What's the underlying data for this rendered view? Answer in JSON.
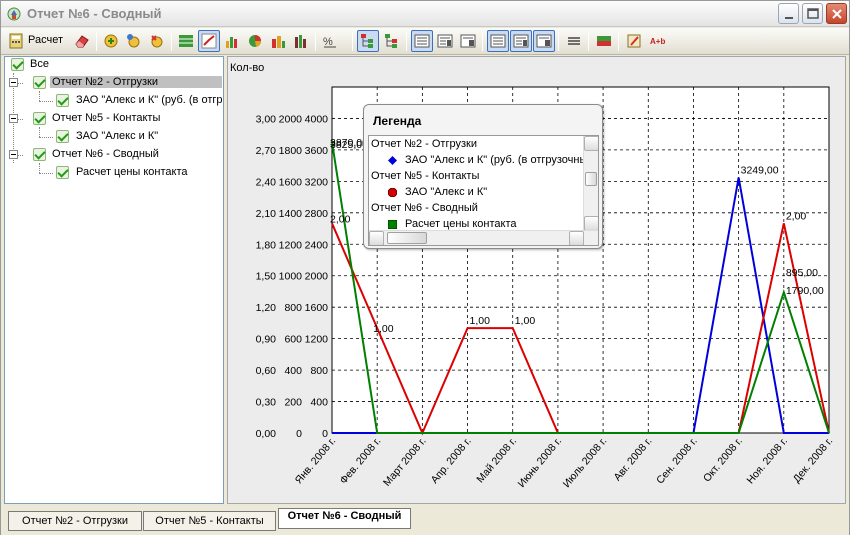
{
  "window": {
    "title": "Отчет №6 - Сводный"
  },
  "toolbar": {
    "calc_label": "Расчет",
    "icons": [
      "eraser-icon",
      "add-report-icon",
      "add-item-icon",
      "add-group-icon",
      "grid-icon",
      "line-chart-icon",
      "bar-chart-icon",
      "pie-chart-icon",
      "chart-3d-icon",
      "column-chart-icon",
      "percent-icon",
      "tree-view-icon",
      "tree-expand-icon",
      "layout-1-icon",
      "layout-2-icon",
      "layout-3-icon",
      "layout-4-icon",
      "layout-5-icon",
      "layout-6-icon",
      "lines-icon",
      "table-icon",
      "edit-icon",
      "font-icon"
    ]
  },
  "tree": {
    "items": [
      {
        "label": "Все"
      },
      {
        "label": "Отчет №2 - Отгрузки"
      },
      {
        "label": "ЗАО \"Алекс и К\" (руб. (в отгр"
      },
      {
        "label": "Отчет №5 - Контакты"
      },
      {
        "label": "ЗАО \"Алекс и К\""
      },
      {
        "label": "Отчет №6 - Сводный"
      },
      {
        "label": "Расчет цены контакта"
      }
    ]
  },
  "legend": {
    "title": "Легенда",
    "rows": [
      {
        "text": "Отчет №2 - Отгрузки",
        "marker": "none"
      },
      {
        "text": "ЗАО \"Алекс и К\" (руб. (в отгрузочны",
        "marker": "diamond",
        "color": "#0000dd"
      },
      {
        "text": "Отчет №5 - Контакты",
        "marker": "none"
      },
      {
        "text": "ЗАО \"Алекс и К\"",
        "marker": "circle",
        "color": "#dd0000"
      },
      {
        "text": "Отчет №6 - Сводный",
        "marker": "none"
      },
      {
        "text": "Расчет цены контакта",
        "marker": "square",
        "color": "#008000"
      }
    ]
  },
  "chart_data": {
    "type": "line",
    "ylabel": "Кол-во",
    "categories": [
      "Янв. 2008 г.",
      "Фев. 2008 г.",
      "Март 2008 г.",
      "Апр. 2008 г.",
      "Май 2008 г.",
      "Июнь 2008 г.",
      "Июль 2008 г.",
      "Авг. 2008 г.",
      "Сен. 2008 г.",
      "Окт. 2008 г.",
      "Ноя. 2008 г.",
      "Дек. 2008 г."
    ],
    "y_axes": [
      {
        "ylim": [
          0,
          3.3
        ],
        "ticks": [
          "0,00",
          "0,30",
          "0,60",
          "0,90",
          "1,20",
          "1,50",
          "1,80",
          "2,10",
          "2,40",
          "2,70",
          "3,00"
        ]
      },
      {
        "ylim": [
          0,
          2200
        ],
        "ticks": [
          "0",
          "200",
          "400",
          "600",
          "800",
          "1000",
          "1200",
          "1400",
          "1600",
          "1800",
          "2000"
        ]
      },
      {
        "ylim": [
          0,
          4400
        ],
        "ticks": [
          "0",
          "400",
          "800",
          "1200",
          "1600",
          "2000",
          "2400",
          "2800",
          "3200",
          "3600",
          "4000"
        ]
      }
    ],
    "series": [
      {
        "name": "ЗАО \"Алекс и К\" (руб. (в отгрузочны",
        "color": "#0000dd",
        "axis": 2,
        "values": [
          0,
          0,
          0,
          0,
          0,
          0,
          0,
          0,
          0,
          3249,
          0,
          0
        ],
        "labels": [
          "",
          "",
          "",
          "",
          "",
          "",
          "",
          "",
          "",
          "3249,00",
          "",
          ""
        ]
      },
      {
        "name": "ЗАО \"Алекс и К\"",
        "color": "#dd0000",
        "axis": 0,
        "values": [
          2,
          1,
          0,
          1,
          1,
          0,
          0,
          0,
          0,
          0,
          2,
          0
        ],
        "labels": [
          "2,00",
          "1,00",
          "",
          "1,00",
          "1,00",
          "",
          "",
          "",
          "",
          "",
          "2,00",
          ""
        ]
      },
      {
        "name": "Расчет цены контакта",
        "color": "#008000",
        "axis": 1,
        "values": [
          1850,
          0,
          0,
          0,
          0,
          0,
          0,
          0,
          0,
          0,
          895,
          0
        ],
        "labels": [
          "3825,00",
          "",
          "",
          "",
          "",
          "",
          "",
          "",
          "",
          "",
          "895,00",
          ""
        ]
      }
    ],
    "extra_labels": [
      "3870,00",
      "1790,00"
    ],
    "grid": true
  },
  "tabs": [
    {
      "label": "Отчет №2 - Отгрузки"
    },
    {
      "label": "Отчет №5 - Контакты"
    },
    {
      "label": "Отчет №6 - Сводный"
    }
  ]
}
